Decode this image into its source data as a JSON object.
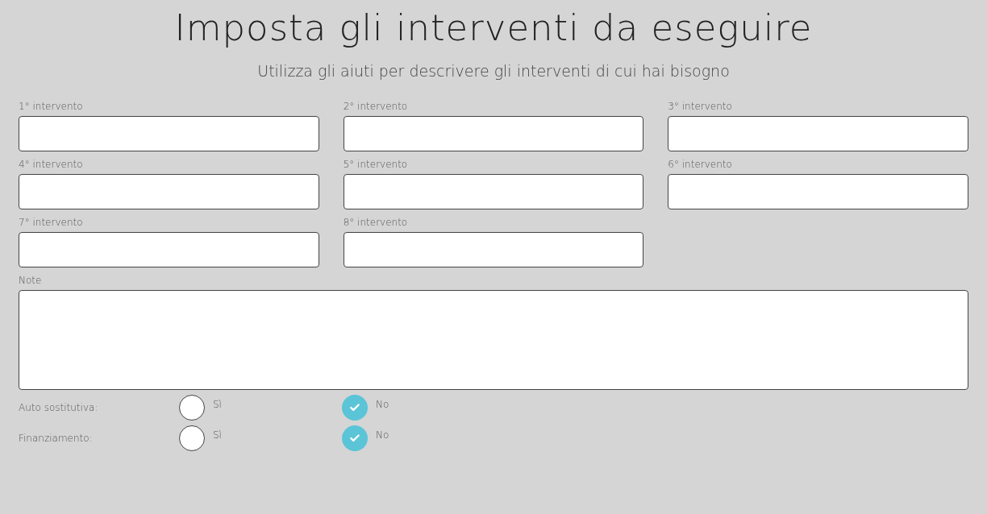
{
  "title": "Imposta gli interventi da eseguire",
  "subtitle": "Utilizza gli aiuti per descrivere gli interventi di cui hai bisogno",
  "fields": [
    {
      "label": "1° intervento"
    },
    {
      "label": "2° intervento"
    },
    {
      "label": "3° intervento"
    },
    {
      "label": "4° intervento"
    },
    {
      "label": "5° intervento"
    },
    {
      "label": "6° intervento"
    },
    {
      "label": "7° intervento"
    },
    {
      "label": "8° intervento"
    }
  ],
  "notes": {
    "label": "Note"
  },
  "choices": [
    {
      "label": "Auto sostitutiva:",
      "options": [
        {
          "label": "Sì",
          "selected": false
        },
        {
          "label": "No",
          "selected": true
        }
      ]
    },
    {
      "label": "Finanziamento:",
      "options": [
        {
          "label": "Sì",
          "selected": false
        },
        {
          "label": "No",
          "selected": true
        }
      ]
    }
  ]
}
